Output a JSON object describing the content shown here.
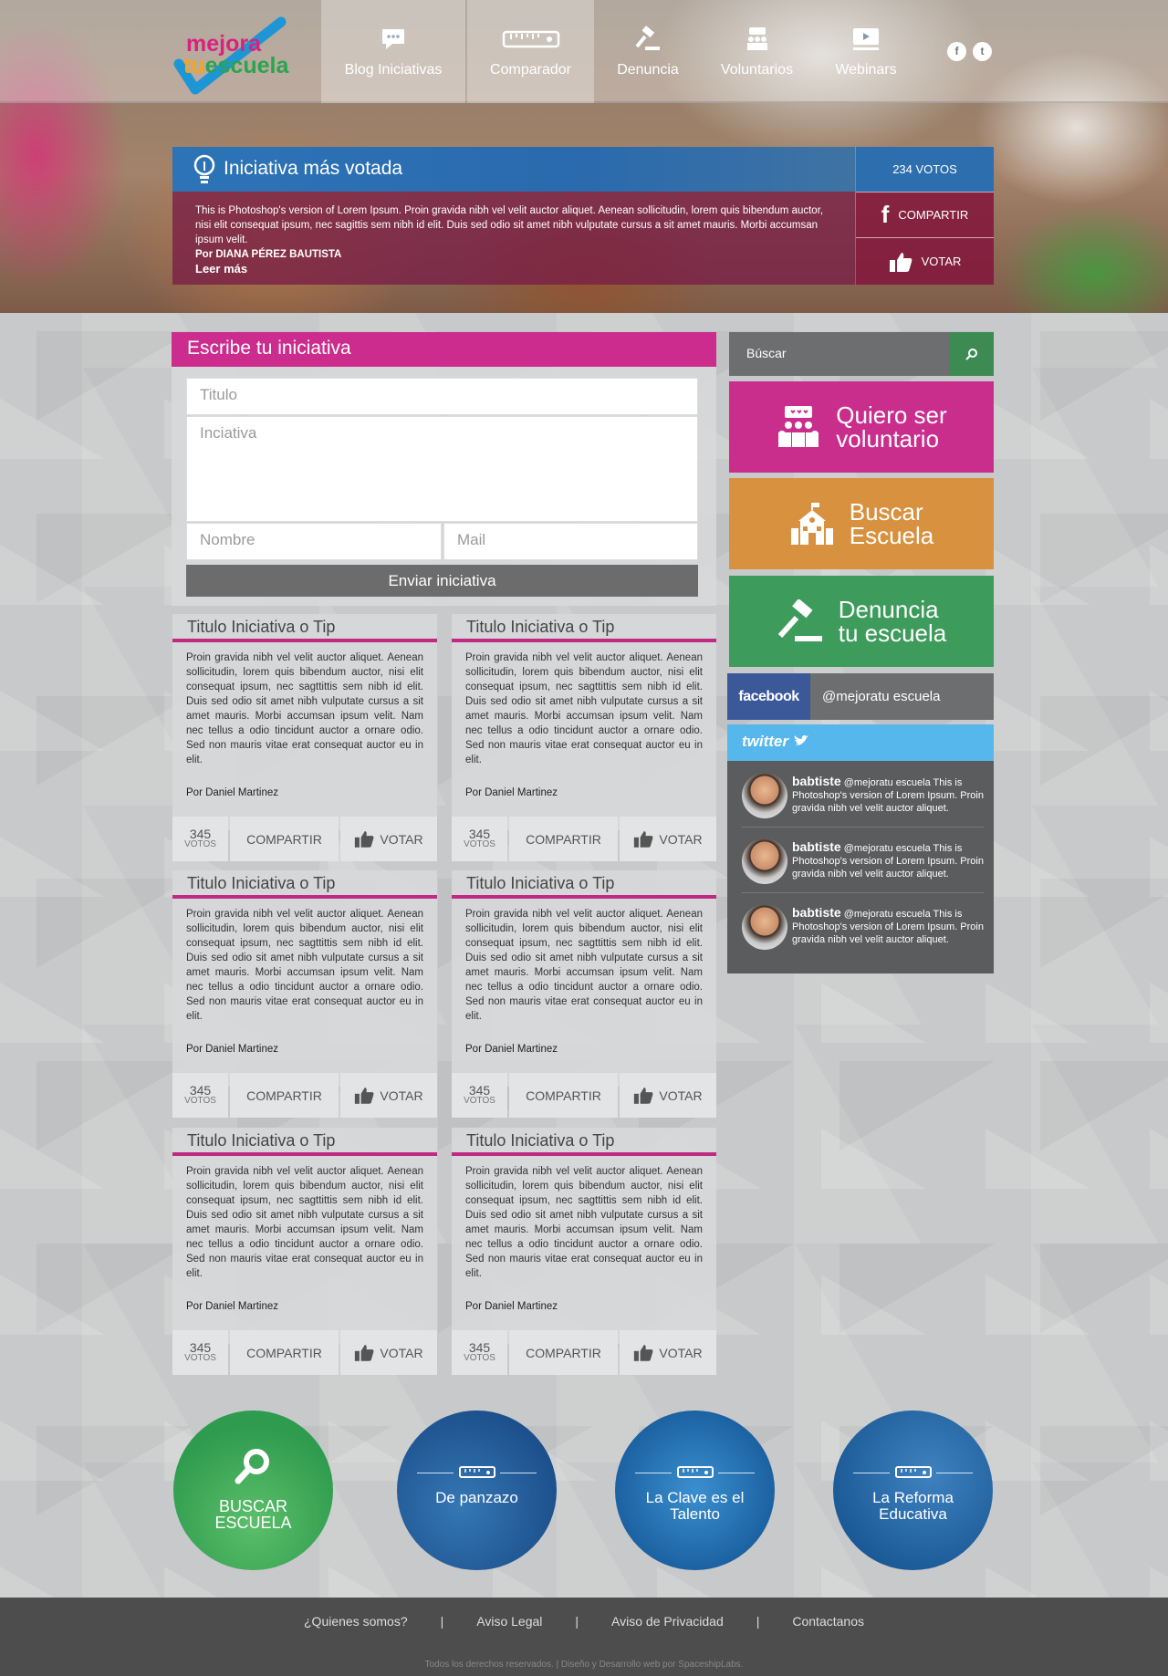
{
  "brand": {
    "line1": "mejora",
    "line2a": "tu",
    "line2b": "escuela"
  },
  "nav": [
    {
      "label": "Blog Iniciativas",
      "icon": "chat-icon"
    },
    {
      "label": "Comparador",
      "icon": "ruler-icon"
    },
    {
      "label": "Denuncia",
      "icon": "gavel-icon"
    },
    {
      "label": "Voluntarios",
      "icon": "people-icon"
    },
    {
      "label": "Webinars",
      "icon": "video-icon"
    }
  ],
  "social": {
    "facebook": "f",
    "twitter": "t"
  },
  "featured": {
    "title": "Iniciativa más votada",
    "text": "This is Photoshop's version  of Lorem Ipsum. Proin gravida nibh vel velit auctor aliquet. Aenean sollicitudin, lorem quis bibendum auctor, nisi elit consequat ipsum, nec sagittis sem nibh id elit. Duis sed odio sit amet nibh vulputate cursus a sit amet mauris. Morbi accumsan ipsum velit.",
    "author": "Por DIANA PÉREZ BAUTISTA",
    "more": "Leer más",
    "votes": "234 VOTOS",
    "share": "COMPARTIR",
    "vote": "VOTAR"
  },
  "form": {
    "title": "Escribe tu iniciativa",
    "title_ph": "Titulo",
    "body_ph": "Inciativa",
    "name_ph": "Nombre",
    "mail_ph": "Mail",
    "submit": "Enviar iniciativa"
  },
  "cards": [
    {
      "title": "Titulo Iniciativa o Tip",
      "text": "Proin gravida nibh vel velit auctor aliquet. Aenean sollicitudin, lorem quis bibendum auctor, nisi elit consequat ipsum, nec sagttittis sem nibh id elit. Duis sed odio sit amet nibh vulputate cursus a sit amet mauris. Morbi accumsan ipsum velit. Nam nec tellus a odio tincidunt auctor a ornare odio. Sed non  mauris vitae erat consequat auctor eu in elit.",
      "author": "Por Daniel Martinez",
      "votes": "345",
      "votes_label": "VOTOS",
      "share": "COMPARTIR",
      "vote": "VOTAR"
    },
    {
      "title": "Titulo Iniciativa o Tip",
      "text": "Proin gravida nibh vel velit auctor aliquet. Aenean sollicitudin, lorem quis bibendum auctor, nisi elit consequat ipsum, nec sagttittis sem nibh id elit. Duis sed odio sit amet nibh vulputate cursus a sit amet mauris. Morbi accumsan ipsum velit. Nam nec tellus a odio tincidunt auctor a ornare odio. Sed non  mauris vitae erat consequat auctor eu in elit.",
      "author": "Por Daniel Martinez",
      "votes": "345",
      "votes_label": "VOTOS",
      "share": "COMPARTIR",
      "vote": "VOTAR"
    },
    {
      "title": "Titulo Iniciativa o Tip",
      "text": "Proin gravida nibh vel velit auctor aliquet. Aenean sollicitudin, lorem quis bibendum auctor, nisi elit consequat ipsum, nec sagttittis sem nibh id elit. Duis sed odio sit amet nibh vulputate cursus a sit amet mauris. Morbi accumsan ipsum velit. Nam nec tellus a odio tincidunt auctor a ornare odio. Sed non  mauris vitae erat consequat auctor eu in elit.",
      "author": "Por Daniel Martinez",
      "votes": "345",
      "votes_label": "VOTOS",
      "share": "COMPARTIR",
      "vote": "VOTAR"
    },
    {
      "title": "Titulo Iniciativa o Tip",
      "text": "Proin gravida nibh vel velit auctor aliquet. Aenean sollicitudin, lorem quis bibendum auctor, nisi elit consequat ipsum, nec sagttittis sem nibh id elit. Duis sed odio sit amet nibh vulputate cursus a sit amet mauris. Morbi accumsan ipsum velit. Nam nec tellus a odio tincidunt auctor a ornare odio. Sed non  mauris vitae erat consequat auctor eu in elit.",
      "author": "Por Daniel Martinez",
      "votes": "345",
      "votes_label": "VOTOS",
      "share": "COMPARTIR",
      "vote": "VOTAR"
    },
    {
      "title": "Titulo Iniciativa o Tip",
      "text": "Proin gravida nibh vel velit auctor aliquet. Aenean sollicitudin, lorem quis bibendum auctor, nisi elit consequat ipsum, nec sagttittis sem nibh id elit. Duis sed odio sit amet nibh vulputate cursus a sit amet mauris. Morbi accumsan ipsum velit. Nam nec tellus a odio tincidunt auctor a ornare odio. Sed non  mauris vitae erat consequat auctor eu in elit.",
      "author": "Por Daniel Martinez",
      "votes": "345",
      "votes_label": "VOTOS",
      "share": "COMPARTIR",
      "vote": "VOTAR"
    },
    {
      "title": "Titulo Iniciativa o Tip",
      "text": "Proin gravida nibh vel velit auctor aliquet. Aenean sollicitudin, lorem quis bibendum auctor, nisi elit consequat ipsum, nec sagttittis sem nibh id elit. Duis sed odio sit amet nibh vulputate cursus a sit amet mauris. Morbi accumsan ipsum velit. Nam nec tellus a odio tincidunt auctor a ornare odio. Sed non  mauris vitae erat consequat auctor eu in elit.",
      "author": "Por Daniel Martinez",
      "votes": "345",
      "votes_label": "VOTOS",
      "share": "COMPARTIR",
      "vote": "VOTAR"
    }
  ],
  "sidebar": {
    "search_label": "Búscar",
    "tiles": [
      {
        "line1": "Quiero ser",
        "line2": "voluntario",
        "color": "#c92e8d",
        "icon": "volunteers-icon"
      },
      {
        "line1": "Buscar",
        "line2": "Escuela",
        "color": "#d8913e",
        "icon": "school-icon"
      },
      {
        "line1": "Denuncia",
        "line2": "tu escuela",
        "color": "#3d9b5c",
        "icon": "gavel-icon"
      }
    ],
    "facebook_label": "facebook",
    "facebook_handle": "@mejoratu escuela",
    "twitter_label": "twitter",
    "tweets": [
      {
        "user": "babtiste",
        "text": "@mejoratu escuela This is Photoshop's version  of Lorem Ipsum. Proin gravida nibh vel velit auctor aliquet."
      },
      {
        "user": "babtiste",
        "text": "@mejoratu escuela This is Photoshop's version  of Lorem Ipsum. Proin gravida nibh vel velit auctor aliquet."
      },
      {
        "user": "babtiste",
        "text": "@mejoratu escuela This is Photoshop's version  of Lorem Ipsum. Proin gravida nibh vel velit auctor aliquet."
      }
    ]
  },
  "circles": [
    {
      "label1": "BUSCAR",
      "label2": "ESCUELA",
      "color": "#3aa356"
    },
    {
      "label1": "De panzazo",
      "label2": "",
      "color": "#1e5c9a"
    },
    {
      "label1": "La Clave es el",
      "label2": "Talento",
      "color": "#1f6eae"
    },
    {
      "label1": "La Reforma",
      "label2": "Educativa",
      "color": "#1a64a4"
    }
  ],
  "footer": {
    "links": [
      "¿Quienes somos?",
      "Aviso Legal",
      "Aviso de Privacidad",
      "Contactanos"
    ],
    "separator": "|",
    "copyright": "Todos los derechos reservados. | Diseño y Desarrollo web por SpaceshipLabs."
  }
}
